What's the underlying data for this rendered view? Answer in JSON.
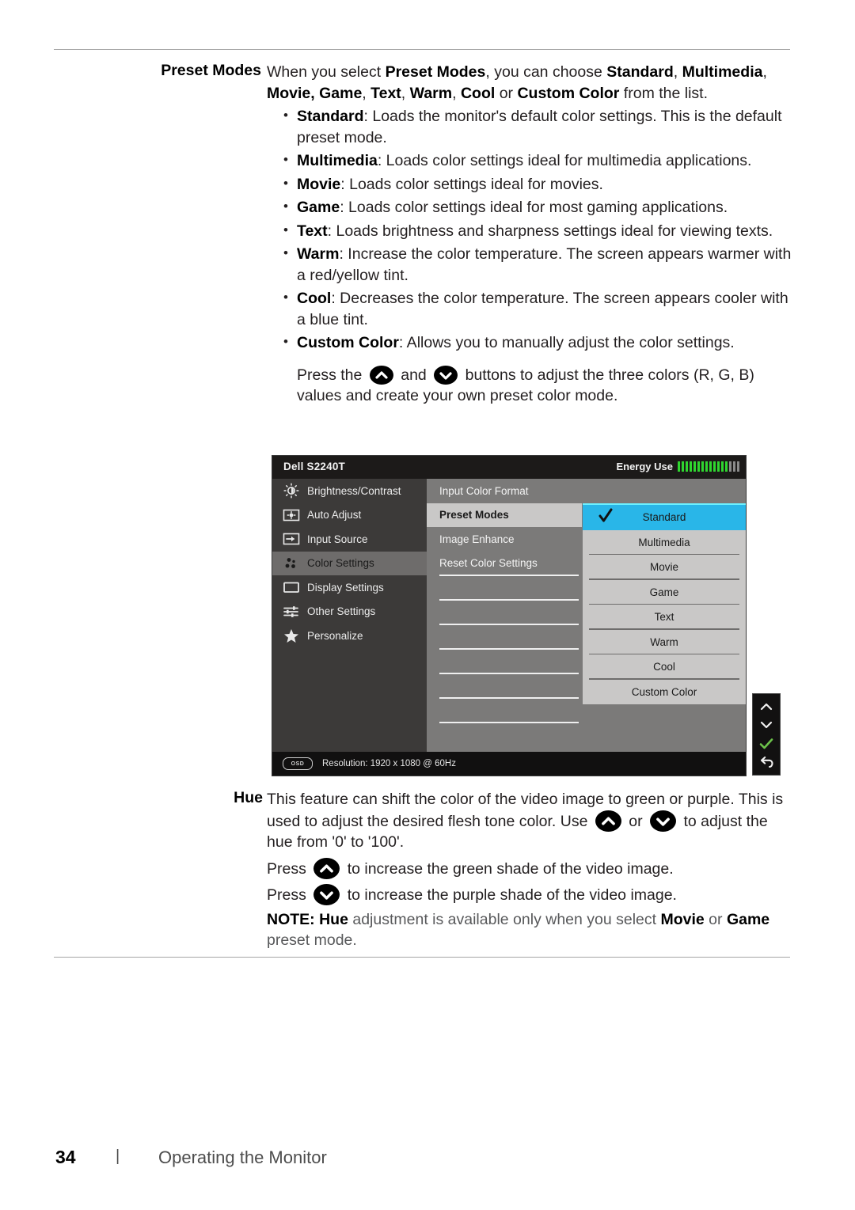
{
  "page": {
    "number": "34",
    "separator": "|",
    "footer_title": "Operating the Monitor"
  },
  "rows": [
    {
      "label": "Preset Modes",
      "intro": {
        "p1": "When you select ",
        "b1": "Preset Modes",
        "p2": ", you can choose ",
        "b2": "Standard",
        "p3": ", ",
        "b3": "Multimedia",
        "p4": ", ",
        "b4": "Movie, Game",
        "p5": ", ",
        "b5": "Text",
        "p6": ", ",
        "b6": "Warm",
        "p7": ", ",
        "b7": "Cool",
        "p8": " or ",
        "b8": "Custom Color",
        "p9": " from the list."
      },
      "bullets": [
        {
          "term": "Standard",
          "text": ": Loads the monitor's default color settings. This is the default preset mode."
        },
        {
          "term": "Multimedia",
          "text": ": Loads color settings ideal for multimedia applications."
        },
        {
          "term": "Movie",
          "text": ": Loads color settings ideal for movies."
        },
        {
          "term": "Game",
          "text": ": Loads color settings ideal for most gaming applications."
        },
        {
          "term": "Text",
          "text": ": Loads brightness and sharpness settings ideal for viewing texts."
        },
        {
          "term": "Warm",
          "text": ": Increase the color temperature. The screen appears warmer with a red/yellow tint."
        },
        {
          "term": "Cool",
          "text": ": Decreases the color temperature. The screen appears cooler with a blue tint."
        },
        {
          "term": "Custom Color",
          "text": ": Allows you to manually adjust the color settings."
        }
      ],
      "press_note": {
        "a": "Press the",
        "b": "and",
        "c": "buttons to adjust the three colors (R, G, B) values and create your own preset color mode."
      }
    }
  ],
  "osd": {
    "title": "Dell S2240T",
    "energy_label": "Energy Use",
    "energy_bars_on": 13,
    "energy_bars_off": 3,
    "nav_items": [
      {
        "label": "Brightness/Contrast",
        "icon": "brightness-icon",
        "active": false
      },
      {
        "label": "Auto Adjust",
        "icon": "auto-adjust-icon",
        "active": false
      },
      {
        "label": "Input Source",
        "icon": "input-source-icon",
        "active": false
      },
      {
        "label": "Color Settings",
        "icon": "color-settings-icon",
        "active": true
      },
      {
        "label": "Display Settings",
        "icon": "display-settings-icon",
        "active": false
      },
      {
        "label": "Other Settings",
        "icon": "other-settings-icon",
        "active": false
      },
      {
        "label": "Personalize",
        "icon": "personalize-star-icon",
        "active": false
      }
    ],
    "mid_items": [
      {
        "label": "Input Color Format",
        "selected": false
      },
      {
        "label": "Preset Modes",
        "selected": true
      },
      {
        "label": "Image Enhance",
        "selected": false
      },
      {
        "label": "Reset Color Settings",
        "selected": false
      }
    ],
    "dropdown_items": [
      {
        "label": "Standard",
        "checked": true
      },
      {
        "label": "Multimedia",
        "checked": false
      },
      {
        "label": "Movie",
        "checked": false
      },
      {
        "label": "Game",
        "checked": false
      },
      {
        "label": "Text",
        "checked": false
      },
      {
        "label": "Warm",
        "checked": false
      },
      {
        "label": "Cool",
        "checked": false
      },
      {
        "label": "Custom Color",
        "checked": false
      }
    ],
    "footer_badge": "OSD",
    "footer_text": "Resolution: 1920 x 1080 @ 60Hz",
    "side_buttons": [
      "up-chevron-icon",
      "down-chevron-icon",
      "check-icon",
      "back-arrow-icon"
    ],
    "colors": {
      "highlight": "#29b6e8",
      "highlight_top": "#6bf0ff",
      "energy_green": "#2fd62f",
      "nav_bg": "#3c3a39",
      "mid_bg": "#7b7a79",
      "drop_bg": "#c9c8c7",
      "header_bg": "#1c1a19",
      "check_green": "#6cc24a"
    }
  },
  "hue": {
    "label": "Hue",
    "line1": "This feature can shift the color of the video image to green or purple. This is used to adjust the desired flesh tone color. Use",
    "or": "or",
    "to": "to",
    "line2": "adjust the hue from '0' to '100'.",
    "press_up_pre": "Press",
    "press_up_post": "to increase the green shade of the video image.",
    "press_down_pre": "Press",
    "press_down_post": "to increase the purple shade of the video image.",
    "note_prefix": "NOTE:",
    "note_term": "Hue",
    "note_mid": " adjustment is available only when you select ",
    "note_b1": "Movie",
    "note_or": " or ",
    "note_b2": "Game",
    "note_tail": " preset mode."
  }
}
